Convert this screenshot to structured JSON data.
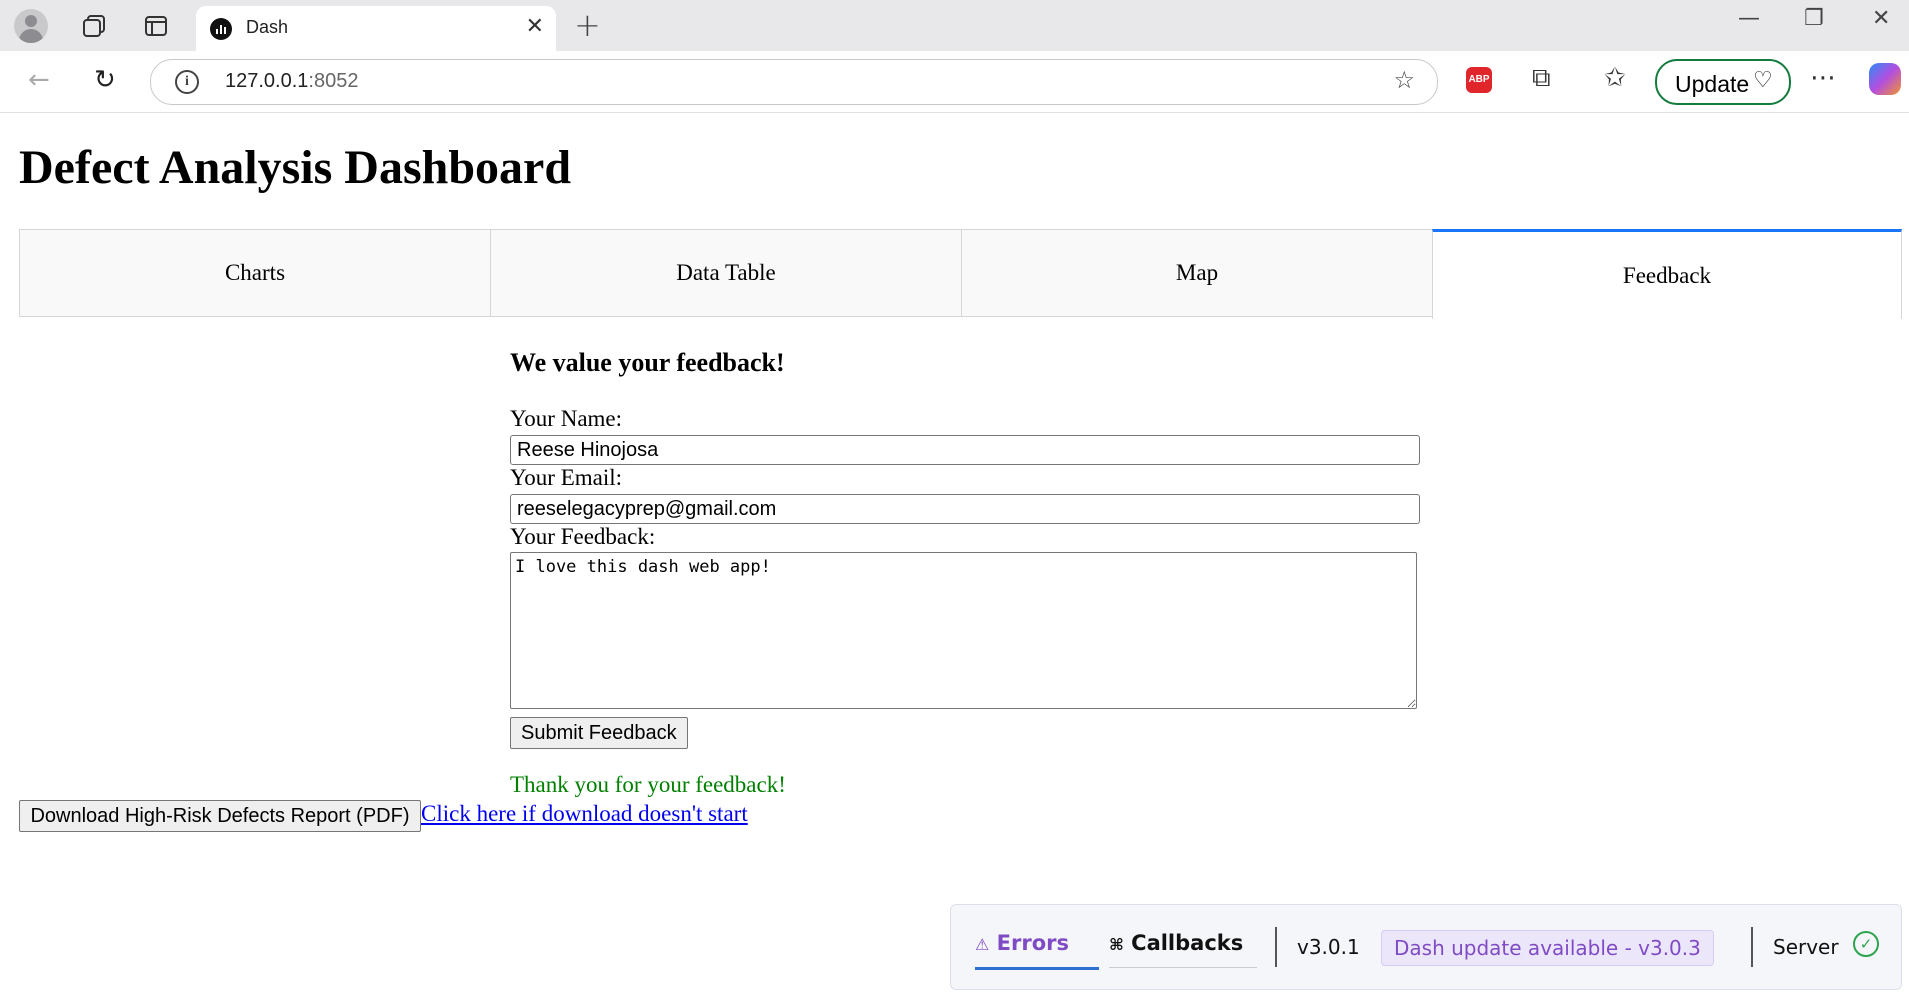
{
  "browser": {
    "tab_title": "Dash",
    "url_host": "127.0.0.1",
    "url_port": ":8052",
    "update_label": "Update",
    "abp_label": "ABP"
  },
  "page": {
    "title": "Defect Analysis Dashboard",
    "tabs": [
      {
        "label": "Charts",
        "active": false
      },
      {
        "label": "Data Table",
        "active": false
      },
      {
        "label": "Map",
        "active": false
      },
      {
        "label": "Feedback",
        "active": true
      }
    ]
  },
  "feedback": {
    "heading": "We value your feedback!",
    "name_label": "Your Name:",
    "name_value": "Reese Hinojosa",
    "email_label": "Your Email:",
    "email_value": "reeselegacyprep@gmail.com",
    "feedback_label": "Your Feedback:",
    "feedback_value": "I love this dash web app!",
    "submit_label": "Submit Feedback",
    "thanks_message": "Thank you for your feedback!"
  },
  "download": {
    "button_label": "Download High-Risk Defects Report (PDF)",
    "link_text": "Click here if download doesn't start"
  },
  "debug": {
    "errors_label": "Errors",
    "callbacks_label": "Callbacks",
    "version": "v3.0.1",
    "update_notice": "Dash update available - v3.0.3",
    "server_label": "Server"
  },
  "colors": {
    "active_tab_accent": "#1975fa",
    "thanks_text": "#008000",
    "link": "#0000ee",
    "debug_accent": "#7f4bc4"
  }
}
